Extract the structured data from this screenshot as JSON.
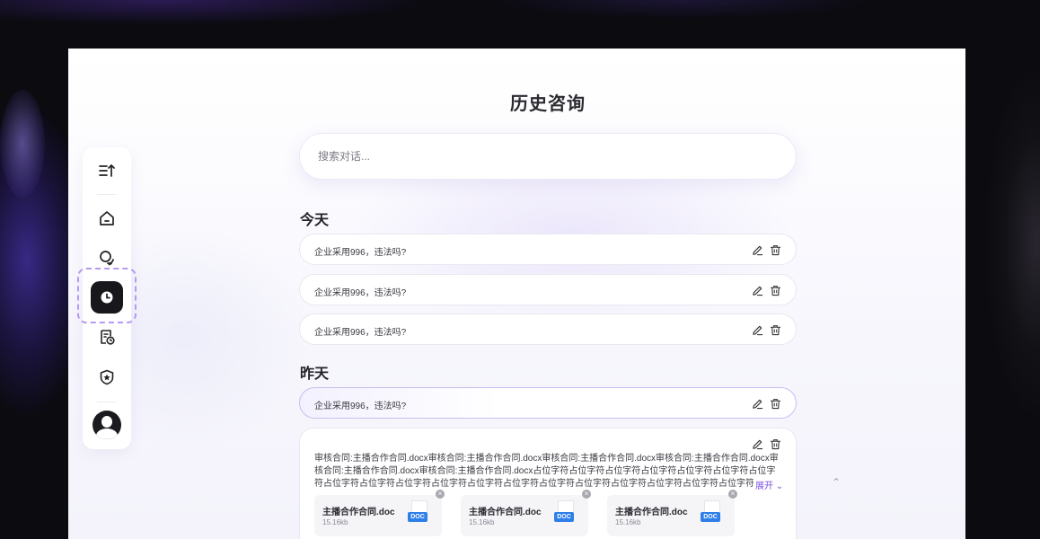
{
  "page": {
    "title": "历史咨询"
  },
  "search": {
    "placeholder": "搜索对话..."
  },
  "sections": {
    "today": {
      "title": "今天",
      "items": [
        {
          "text": "企业采用996，违法吗?"
        },
        {
          "text": "企业采用996，违法吗?"
        },
        {
          "text": "企业采用996，违法吗?"
        }
      ]
    },
    "yesterday": {
      "title": "昨天",
      "items": [
        {
          "text": "企业采用996，违法吗?",
          "active": true
        }
      ]
    }
  },
  "detail": {
    "text": "审核合同:主播合作合同.docx审核合同:主播合作合同.docx审核合同:主播合作合同.docx审核合同:主播合作合同.docx审核合同:主播合作合同.docx审核合同:主播合作合同.docx占位字符占位字符占位字符占位字符占位字符占位字符占位字符占位字符占位字符占位字符占位字符占位字符占位字符占位字符占位字符占位字符占位字符占位字符占位字符...",
    "expand_label": "展开",
    "files": [
      {
        "name": "主播合作合同.doc",
        "size": "15.16kb",
        "type": "DOC"
      },
      {
        "name": "主播合作合同.doc",
        "size": "15.16kb",
        "type": "DOC"
      },
      {
        "name": "主播合作合同.doc",
        "size": "15.16kb",
        "type": "DOC"
      }
    ]
  },
  "sidebar": {
    "items": [
      {
        "icon": "collapse-menu-icon"
      },
      {
        "icon": "home-icon"
      },
      {
        "icon": "chat-bubbles-icon"
      },
      {
        "icon": "history-clock-icon",
        "active": true
      },
      {
        "icon": "document-clock-icon"
      },
      {
        "icon": "shield-star-icon"
      },
      {
        "icon": "user-avatar-icon"
      }
    ]
  },
  "colors": {
    "accent": "#7a4fe0",
    "active_ring": "#b79af0",
    "doc_badge": "#2f7fe8",
    "sidebar_active_bg": "#17171c"
  }
}
